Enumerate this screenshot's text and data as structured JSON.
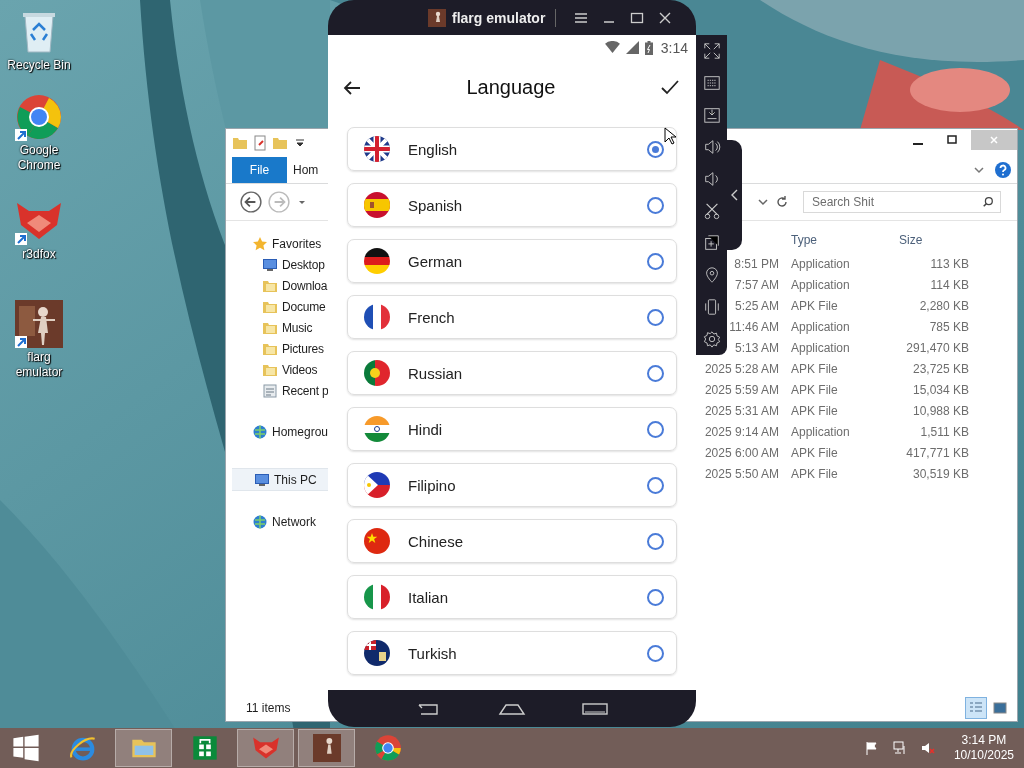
{
  "desktop_icons": [
    {
      "label": "Recycle Bin",
      "kind": "recycle"
    },
    {
      "label": "Google Chrome",
      "kind": "chrome"
    },
    {
      "label": "r3dfox",
      "kind": "r3dfox"
    },
    {
      "label": "flarg emulator",
      "kind": "flarg"
    }
  ],
  "explorer": {
    "ribbon_tabs": [
      {
        "label": "File",
        "selected": true
      },
      {
        "label": "Hom",
        "selected": false
      }
    ],
    "search": {
      "placeholder": "Search Shit"
    },
    "nav": [
      {
        "label": "Favorites",
        "kind": "favorites",
        "selected": false,
        "children": [
          {
            "label": "Desktop",
            "kind": "desktop",
            "selected": false
          },
          {
            "label": "Downloa",
            "kind": "downloads",
            "selected": false
          },
          {
            "label": "Docume",
            "kind": "documents",
            "selected": false
          },
          {
            "label": "Music",
            "kind": "music",
            "selected": false
          },
          {
            "label": "Pictures",
            "kind": "pictures",
            "selected": false
          },
          {
            "label": "Videos",
            "kind": "videos",
            "selected": false
          },
          {
            "label": "Recent p",
            "kind": "recent",
            "selected": false
          }
        ]
      },
      {
        "label": "Homegrou",
        "kind": "homegroup",
        "selected": false
      },
      {
        "label": "This PC",
        "kind": "pc",
        "selected": true
      },
      {
        "label": "Network",
        "kind": "network",
        "selected": false
      }
    ],
    "columns": [
      "Type",
      "Size"
    ],
    "rows": [
      {
        "date": "8:51 PM",
        "type": "Application",
        "size": "113 KB"
      },
      {
        "date": "7:57 AM",
        "type": "Application",
        "size": "114 KB"
      },
      {
        "date": "5:25 AM",
        "type": "APK File",
        "size": "2,280 KB"
      },
      {
        "date": "11:46 AM",
        "type": "Application",
        "size": "785 KB"
      },
      {
        "date": "5:13 AM",
        "type": "Application",
        "size": "291,470 KB"
      },
      {
        "date": "2025 5:28 AM",
        "type": "APK File",
        "size": "23,725 KB"
      },
      {
        "date": "2025 5:59 AM",
        "type": "APK File",
        "size": "15,034 KB"
      },
      {
        "date": "2025 5:31 AM",
        "type": "APK File",
        "size": "10,988 KB"
      },
      {
        "date": "2025 9:14 AM",
        "type": "Application",
        "size": "1,511 KB"
      },
      {
        "date": "2025 6:00 AM",
        "type": "APK File",
        "size": "417,771 KB"
      },
      {
        "date": "2025 5:50 AM",
        "type": "APK File",
        "size": "30,519 KB"
      }
    ],
    "status": "11 items",
    "views": [
      {
        "kind": "details",
        "selected": true
      },
      {
        "kind": "tiles",
        "selected": false
      }
    ]
  },
  "emulator": {
    "title": "flarg emulator",
    "time": "3:14",
    "screen_title": "Language",
    "languages": [
      {
        "name": "English",
        "kind": "gb",
        "selected": true
      },
      {
        "name": "Spanish",
        "kind": "es",
        "selected": false
      },
      {
        "name": "German",
        "kind": "de",
        "selected": false
      },
      {
        "name": "French",
        "kind": "fr",
        "selected": false
      },
      {
        "name": "Russian",
        "kind": "pt",
        "selected": false
      },
      {
        "name": "Hindi",
        "kind": "in",
        "selected": false
      },
      {
        "name": "Filipino",
        "kind": "ph",
        "selected": false
      },
      {
        "name": "Chinese",
        "kind": "cn",
        "selected": false
      },
      {
        "name": "Italian",
        "kind": "it",
        "selected": false
      },
      {
        "name": "Turkish",
        "kind": "ensign",
        "selected": false
      }
    ]
  },
  "taskbar": {
    "apps": [
      {
        "kind": "start",
        "active": false
      },
      {
        "kind": "ie",
        "active": false
      },
      {
        "kind": "explorer",
        "active": true
      },
      {
        "kind": "store",
        "active": false
      },
      {
        "kind": "r3dfox",
        "active": true
      },
      {
        "kind": "flarg",
        "active": true
      },
      {
        "kind": "chrome",
        "active": false
      }
    ],
    "time": "3:14 PM",
    "date": "10/10/2025"
  }
}
